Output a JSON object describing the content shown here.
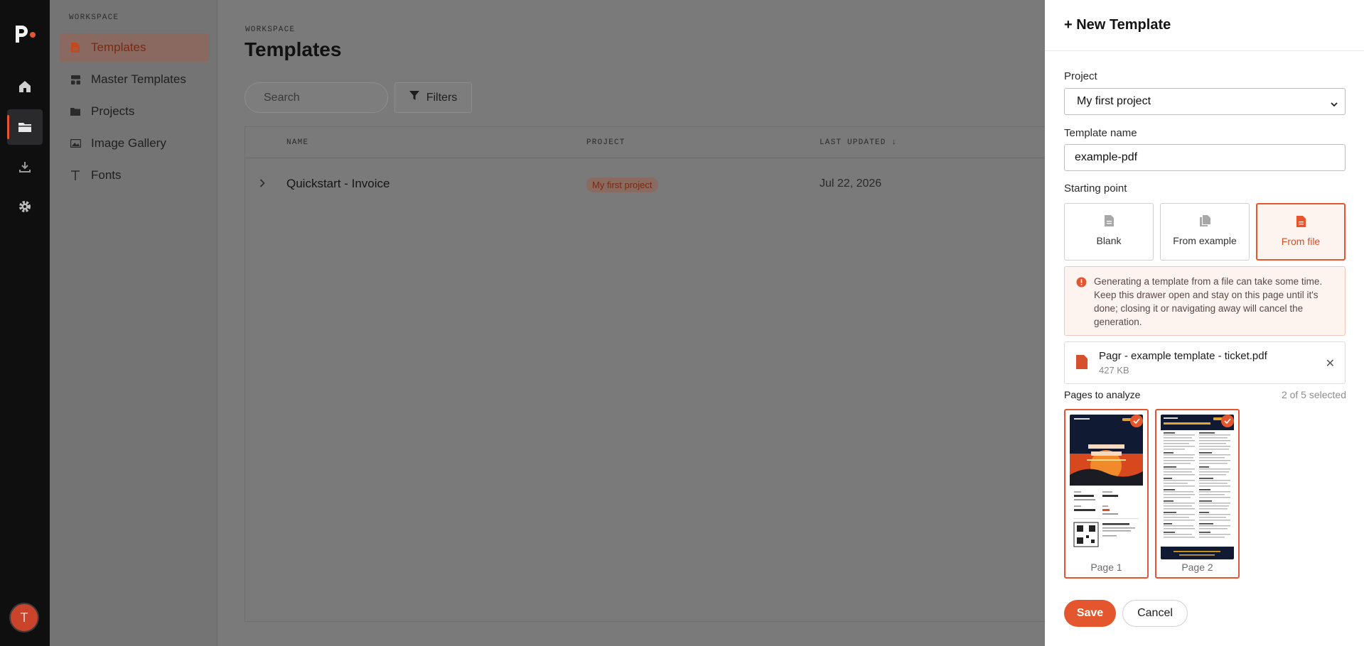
{
  "rail": {
    "logo": "pagr-logo",
    "items": [
      "home-icon",
      "folder-icon",
      "download-icon",
      "gear-icon"
    ],
    "avatar_initial": "T"
  },
  "sidebar": {
    "section_title": "WORKSPACE",
    "items": [
      {
        "label": "Templates",
        "icon": "document-icon"
      },
      {
        "label": "Master Templates",
        "icon": "layout-icon"
      },
      {
        "label": "Projects",
        "icon": "folder-icon"
      },
      {
        "label": "Image Gallery",
        "icon": "image-icon"
      },
      {
        "label": "Fonts",
        "icon": "font-icon"
      }
    ]
  },
  "main": {
    "breadcrumb": "WORKSPACE",
    "title": "Templates",
    "search_placeholder": "Search",
    "filters_label": "Filters",
    "columns": {
      "name": "NAME",
      "project": "PROJECT",
      "last_updated": "LAST UPDATED ↓"
    },
    "rows": [
      {
        "name": "Quickstart - Invoice",
        "project": "My first project",
        "last_updated": "Jul 22, 2026"
      }
    ]
  },
  "drawer": {
    "title": "+ New Template",
    "project_label": "Project",
    "project_value": "My first project",
    "template_name_label": "Template name",
    "template_name_value": "example-pdf",
    "starting_point_label": "Starting point",
    "starting_points": [
      {
        "label": "Blank",
        "icon": "document-icon"
      },
      {
        "label": "From example",
        "icon": "copy-icon"
      },
      {
        "label": "From file",
        "icon": "file-icon",
        "selected": true
      }
    ],
    "warning": "Generating a template from a file can take some time. Keep this drawer open and stay on this page until it's done; closing it or navigating away will cancel the generation.",
    "file": {
      "name": "Pagr - example template - ticket.pdf",
      "size": "427 KB"
    },
    "pages_label": "Pages to analyze",
    "pages_count": "2 of 5 selected",
    "pages": [
      {
        "label": "Page 1",
        "selected": true
      },
      {
        "label": "Page 2",
        "selected": true
      }
    ],
    "save_label": "Save",
    "cancel_label": "Cancel"
  },
  "colors": {
    "accent": "#e4572e",
    "rail": "#0f0f10",
    "overlay": "#7a7a7a"
  }
}
